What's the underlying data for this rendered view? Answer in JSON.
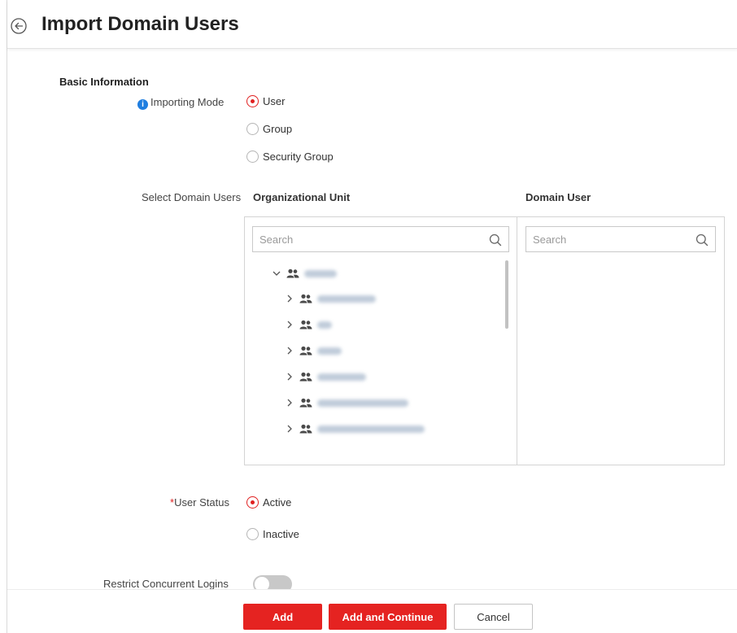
{
  "header": {
    "title": "Import Domain Users",
    "back_icon": "circle-arrow-left-icon"
  },
  "basic_information": {
    "title": "Basic Information",
    "importing_mode": {
      "label": "Importing Mode",
      "info_icon": "info-icon",
      "options": [
        "User",
        "Group",
        "Security Group"
      ],
      "selected": "User"
    }
  },
  "select_domain_users": {
    "label": "Select Domain Users",
    "org_unit": {
      "heading": "Organizational Unit",
      "search_placeholder": "Search",
      "tree": {
        "root": {
          "expanded": true,
          "icon": "group-icon"
        },
        "children_count_visible": 6
      }
    },
    "domain_user": {
      "heading": "Domain User",
      "search_placeholder": "Search"
    }
  },
  "user_status": {
    "label": "User Status",
    "required_mark": "*",
    "options": [
      "Active",
      "Inactive"
    ],
    "selected": "Active"
  },
  "restrict_concurrent_logins": {
    "label": "Restrict Concurrent Logins",
    "enabled": false
  },
  "footer": {
    "add_label": "Add",
    "add_continue_label": "Add and Continue",
    "cancel_label": "Cancel"
  },
  "colors": {
    "accent": "#e52321",
    "info": "#1f7ee0",
    "border": "#d4d4d4"
  }
}
